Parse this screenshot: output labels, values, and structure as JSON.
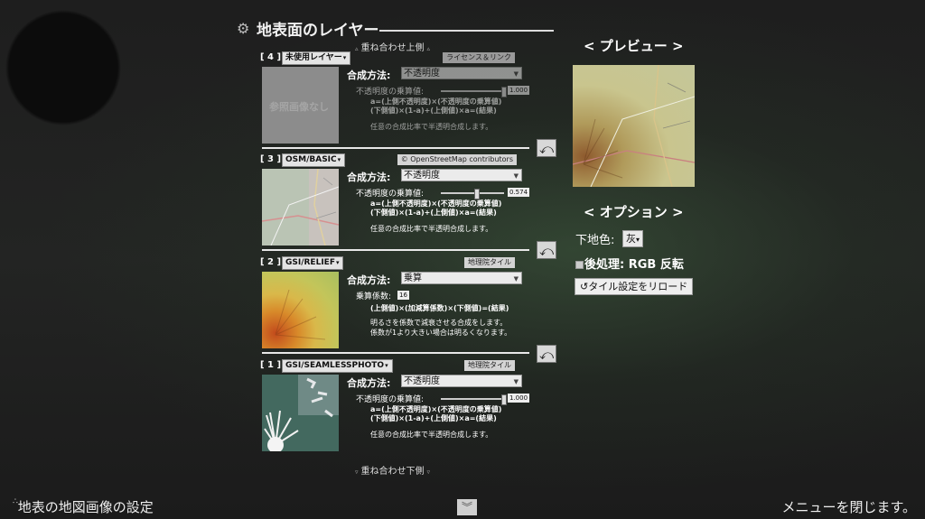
{
  "header": {
    "title": "地表面のレイヤー",
    "icon": "gear-icon"
  },
  "stack": {
    "top_label": "重ね合わせ上側",
    "bottom_label": "重ね合わせ下側"
  },
  "layers": [
    {
      "number": "[ 4 ]",
      "source": "未使用レイヤー",
      "license": "ライセンス＆リンク",
      "thumb_text": "参照画像なし",
      "blend_label": "合成方法:",
      "blend_mode": "不透明度",
      "param_label": "不透明度の乗算値:",
      "param_value": "1.000",
      "param_fraction": 1.0,
      "formula_line1": "a=(上側不透明度)×(不透明度の乗算値)",
      "formula_line2": "(下側値)×(1-a)+(上側値)×a=(結果)",
      "desc_line1": "任意の合成比率で半透明合成します。",
      "desc_line2": ""
    },
    {
      "number": "[ 3 ]",
      "source": "OSM/BASIC",
      "license": "© OpenStreetMap contributors",
      "blend_label": "合成方法:",
      "blend_mode": "不透明度",
      "param_label": "不透明度の乗算値:",
      "param_value": "0.574",
      "param_fraction": 0.574,
      "formula_line1": "a=(上側不透明度)×(不透明度の乗算値)",
      "formula_line2": "(下側値)×(1-a)+(上側値)×a=(結果)",
      "desc_line1": "任意の合成比率で半透明合成します。",
      "desc_line2": ""
    },
    {
      "number": "[ 2 ]",
      "source": "GSI/RELIEF",
      "license": "地理院タイル",
      "blend_label": "合成方法:",
      "blend_mode": "乗算",
      "param_label": "乗算係数:",
      "param_value": "16",
      "formula_line1": "(上側値)×(加減算係数)×(下側値)=(結果)",
      "formula_line2": "",
      "desc_line1": "明るさを係数で減衰させる合成をします。",
      "desc_line2": "係数が1より大きい場合は明るくなります。"
    },
    {
      "number": "[ 1 ]",
      "source": "GSI/SEAMLESSPHOTO",
      "license": "地理院タイル",
      "blend_label": "合成方法:",
      "blend_mode": "不透明度",
      "param_label": "不透明度の乗算値:",
      "param_value": "1.000",
      "param_fraction": 1.0,
      "formula_line1": "a=(上側不透明度)×(不透明度の乗算値)",
      "formula_line2": "(下側値)×(1-a)+(上側値)×a=(結果)",
      "desc_line1": "任意の合成比率で半透明合成します。",
      "desc_line2": ""
    }
  ],
  "swap_icon": "swap-layers-icon",
  "preview": {
    "title": "< プレビュー >"
  },
  "options": {
    "title": "< オプション >",
    "background_label": "下地色:",
    "background_value": "灰",
    "postprocess_label": "後処理: RGB 反転",
    "postprocess_checked": false,
    "reload_label": "タイル設定をリロード",
    "reload_icon": "reload-icon"
  },
  "footer": {
    "left": "地表の地図画像の設定",
    "right": "メニューを閉じます。",
    "chevron": "chevron-down-icon"
  }
}
